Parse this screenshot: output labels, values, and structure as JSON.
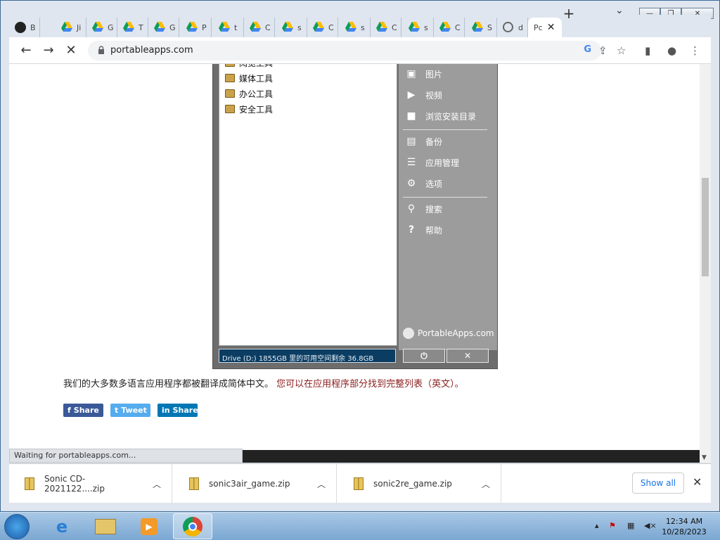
{
  "window": {
    "minimize": "—",
    "maximize": "❐",
    "close": "✕"
  },
  "tabs": [
    {
      "label": "B",
      "icon": "github-icon"
    },
    {
      "label": "Ji",
      "icon": "google-drive-icon"
    },
    {
      "label": "G",
      "icon": "google-drive-icon"
    },
    {
      "label": "T",
      "icon": "google-drive-icon"
    },
    {
      "label": "G",
      "icon": "google-drive-icon"
    },
    {
      "label": "P",
      "icon": "google-drive-icon"
    },
    {
      "label": "t",
      "icon": "google-drive-icon"
    },
    {
      "label": "C",
      "icon": "google-drive-icon"
    },
    {
      "label": "s",
      "icon": "google-drive-icon"
    },
    {
      "label": "C",
      "icon": "google-drive-icon"
    },
    {
      "label": "s",
      "icon": "google-drive-icon"
    },
    {
      "label": "C",
      "icon": "google-drive-icon"
    },
    {
      "label": "s",
      "icon": "google-drive-icon"
    },
    {
      "label": "C",
      "icon": "google-drive-icon"
    },
    {
      "label": "S",
      "icon": "google-drive-icon"
    },
    {
      "label": "d",
      "icon": "globe-icon"
    },
    {
      "label": "Pc",
      "icon": "none",
      "active": true
    }
  ],
  "toolbar": {
    "url": "portableapps.com",
    "back": "←",
    "forward": "→",
    "reload": "✕"
  },
  "pa": {
    "list_items": [
      "阅览工具",
      "媒体工具",
      "办公工具",
      "安全工具"
    ],
    "menu1": [
      {
        "label": "图片",
        "icon": "pictures-icon",
        "glyph": "▣"
      },
      {
        "label": "视频",
        "icon": "video-icon",
        "glyph": "▶"
      },
      {
        "label": "浏览安装目录",
        "icon": "folder-icon",
        "glyph": "■"
      }
    ],
    "menu2": [
      {
        "label": "备份",
        "icon": "briefcase-icon",
        "glyph": "▤"
      },
      {
        "label": "应用管理",
        "icon": "list-icon",
        "glyph": "☰"
      },
      {
        "label": "选项",
        "icon": "gear-icon",
        "glyph": "⚙"
      }
    ],
    "menu3": [
      {
        "label": "搜索",
        "icon": "search-icon",
        "glyph": "⚲"
      },
      {
        "label": "帮助",
        "icon": "help-icon",
        "glyph": "?"
      }
    ],
    "brand": "PortableApps.com",
    "status": "Drive (D:) 1855GB 里的可用空间剩余 36.8GB",
    "power": "⏻",
    "close": "✕"
  },
  "content": {
    "paragraph": "我们的大多数多语言应用程序都被翻译成简体中文。",
    "link": "您可以在应用程序部分找到完整列表（英文）。",
    "shares": [
      {
        "label": "Share",
        "icon": "facebook-icon",
        "glyph": "f",
        "color": "#3b5998"
      },
      {
        "label": "Tweet",
        "icon": "twitter-icon",
        "glyph": "t",
        "color": "#55acee"
      },
      {
        "label": "Share",
        "icon": "linkedin-icon",
        "glyph": "in",
        "color": "#0077b5"
      }
    ]
  },
  "status": "Waiting for portableapps.com...",
  "downloads": [
    {
      "name": "Sonic CD-2021122....zip"
    },
    {
      "name": "sonic3air_game.zip"
    },
    {
      "name": "sonic2re_game.zip"
    }
  ],
  "shelf": {
    "show_all": "Show all"
  },
  "taskbar": {
    "time": "12:34 AM",
    "date": "10/28/2023"
  }
}
